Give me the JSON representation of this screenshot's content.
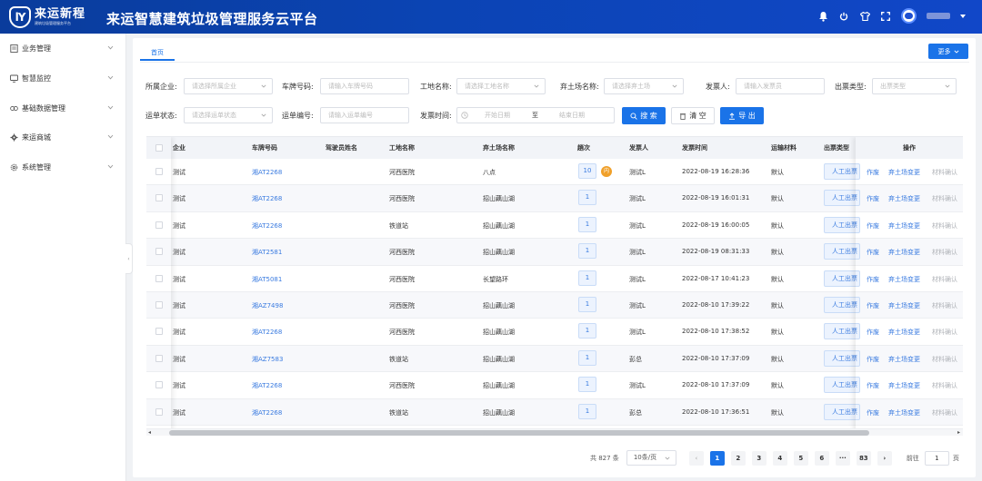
{
  "header": {
    "logo_mark": "lY",
    "logo_name": "来运新程",
    "logo_sub": "建筑垃圾管理服务平台",
    "title": "来运智慧建筑垃圾管理服务云平台"
  },
  "sidebar": {
    "items": [
      {
        "label": "业务管理",
        "icon": "document-icon"
      },
      {
        "label": "智慧监控",
        "icon": "monitor-icon"
      },
      {
        "label": "基础数据管理",
        "icon": "data-icon"
      },
      {
        "label": "来运商城",
        "icon": "gear-icon"
      },
      {
        "label": "系统管理",
        "icon": "settings-icon"
      }
    ]
  },
  "tabs": {
    "home": "首页"
  },
  "more_button": "更多",
  "filters": {
    "company_label": "所属企业:",
    "company_placeholder": "请选择所属企业",
    "plate_label": "车牌号码:",
    "plate_placeholder": "请输入车牌号码",
    "site_label": "工地名称:",
    "site_placeholder": "请选择工地名称",
    "dump_label": "弃土场名称:",
    "dump_placeholder": "请选择弃土场",
    "issuer_label": "发票人:",
    "issuer_placeholder": "请输入发票员",
    "ticket_type_label": "出票类型:",
    "ticket_type_placeholder": "出票类型",
    "status_label": "运单状态:",
    "status_placeholder": "请选择运单状态",
    "waybill_label": "运单编号:",
    "waybill_placeholder": "请输入运单编号",
    "time_label": "发票时间:",
    "start_placeholder": "开始日期",
    "to": "至",
    "end_placeholder": "结束日期",
    "search_button": "搜 索",
    "clear_button": "清 空",
    "export_button": "导 出"
  },
  "table": {
    "headers": [
      "企业",
      "车牌号码",
      "驾驶员姓名",
      "工地名称",
      "弃土场名称",
      "趟次",
      "发票人",
      "发票时间",
      "运输材料",
      "出票类型",
      "操作"
    ],
    "rows": [
      {
        "company": "测试",
        "plate": "湘AT2268",
        "driver": "",
        "site": "河西医院",
        "dump": "八点",
        "times": "10",
        "tag": "内",
        "issuer": "测试L",
        "time": "2022-08-19 16:28:36",
        "material": "默认"
      },
      {
        "company": "测试",
        "plate": "湘AT2268",
        "driver": "",
        "site": "河西医院",
        "dump": "招山藕山湖",
        "times": "1",
        "tag": "",
        "issuer": "测试L",
        "time": "2022-08-19 16:01:31",
        "material": "默认"
      },
      {
        "company": "测试",
        "plate": "湘AT2268",
        "driver": "",
        "site": "铁道站",
        "dump": "招山藕山湖",
        "times": "1",
        "tag": "",
        "issuer": "测试L",
        "time": "2022-08-19 16:00:05",
        "material": "默认"
      },
      {
        "company": "测试",
        "plate": "湘AT2581",
        "driver": "",
        "site": "河西医院",
        "dump": "招山藕山湖",
        "times": "1",
        "tag": "",
        "issuer": "测试L",
        "time": "2022-08-19 08:31:33",
        "material": "默认"
      },
      {
        "company": "测试",
        "plate": "湘AT5081",
        "driver": "",
        "site": "河西医院",
        "dump": "长望路环",
        "times": "1",
        "tag": "",
        "issuer": "测试L",
        "time": "2022-08-17 10:41:23",
        "material": "默认"
      },
      {
        "company": "测试",
        "plate": "湘AZ7498",
        "driver": "",
        "site": "河西医院",
        "dump": "招山藕山湖",
        "times": "1",
        "tag": "",
        "issuer": "测试L",
        "time": "2022-08-10 17:39:22",
        "material": "默认"
      },
      {
        "company": "测试",
        "plate": "湘AT2268",
        "driver": "",
        "site": "河西医院",
        "dump": "招山藕山湖",
        "times": "1",
        "tag": "",
        "issuer": "测试L",
        "time": "2022-08-10 17:38:52",
        "material": "默认"
      },
      {
        "company": "测试",
        "plate": "湘AZ7583",
        "driver": "",
        "site": "铁道站",
        "dump": "招山藕山湖",
        "times": "1",
        "tag": "",
        "issuer": "彭总",
        "time": "2022-08-10 17:37:09",
        "material": "默认"
      },
      {
        "company": "测试",
        "plate": "湘AT2268",
        "driver": "",
        "site": "河西医院",
        "dump": "招山藕山湖",
        "times": "1",
        "tag": "",
        "issuer": "测试L",
        "time": "2022-08-10 17:37:09",
        "material": "默认"
      },
      {
        "company": "测试",
        "plate": "湘AT2268",
        "driver": "",
        "site": "铁道站",
        "dump": "招山藕山湖",
        "times": "1",
        "tag": "",
        "issuer": "彭总",
        "time": "2022-08-10 17:36:51",
        "material": "默认"
      }
    ],
    "ticket_type_button": "人工出票",
    "actions": {
      "void": "作废",
      "change_dump": "弃土场变更",
      "material_confirm": "材料确认"
    }
  },
  "pagination": {
    "total": "共 827 条",
    "page_size": "10条/页",
    "pages": [
      "1",
      "2",
      "3",
      "4",
      "5",
      "6",
      "···",
      "83"
    ],
    "goto_label": "前往",
    "goto_value": "1",
    "goto_suffix": "页"
  },
  "colors": {
    "primary": "#1a73e8",
    "header": "#0b44b4",
    "badge": "#f0a02a"
  }
}
